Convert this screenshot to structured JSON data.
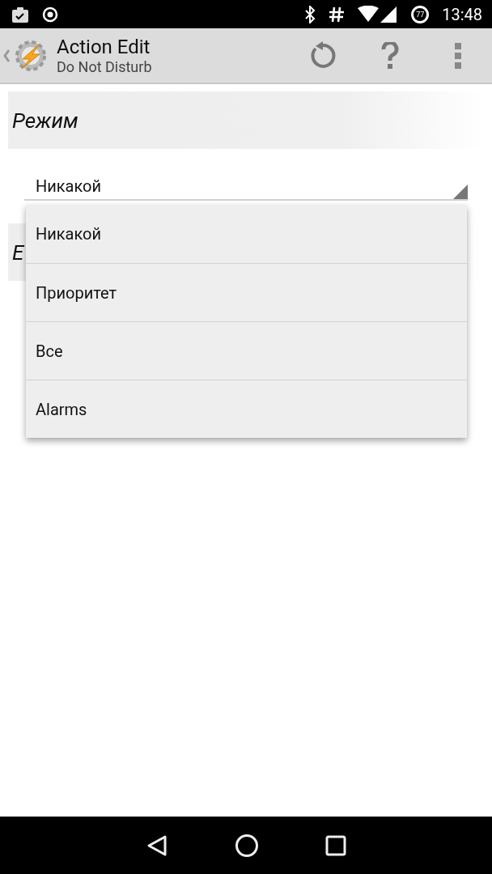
{
  "status_bar": {
    "battery": "77",
    "time": "13:48"
  },
  "app_bar": {
    "title": "Action Edit",
    "subtitle": "Do Not Disturb"
  },
  "sections": [
    {
      "title": "Режим"
    },
    {
      "title": "E"
    }
  ],
  "mode_spinner": {
    "value": "Никакой",
    "expanded": true
  },
  "dropdown": {
    "options": [
      {
        "label": "Никакой",
        "selected": false
      },
      {
        "label": "Приоритет",
        "selected": false
      },
      {
        "label": "Все",
        "selected": false
      },
      {
        "label": "Alarms",
        "selected": false
      }
    ]
  }
}
